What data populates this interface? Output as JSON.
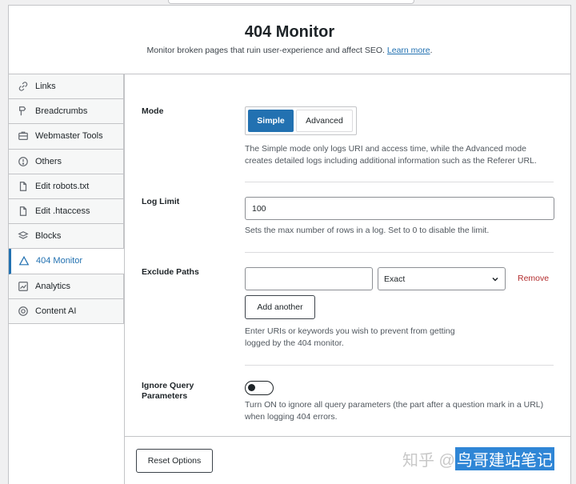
{
  "header": {
    "title": "404 Monitor",
    "subtitle": "Monitor broken pages that ruin user-experience and affect SEO.",
    "learn_more": "Learn more",
    "period": "."
  },
  "sidebar": {
    "items": [
      {
        "label": "Links",
        "icon": "links-icon"
      },
      {
        "label": "Breadcrumbs",
        "icon": "breadcrumbs-icon"
      },
      {
        "label": "Webmaster Tools",
        "icon": "webmaster-tools-icon"
      },
      {
        "label": "Others",
        "icon": "others-icon"
      },
      {
        "label": "Edit robots.txt",
        "icon": "file-icon"
      },
      {
        "label": "Edit .htaccess",
        "icon": "file-icon"
      },
      {
        "label": "Blocks",
        "icon": "blocks-icon"
      },
      {
        "label": "404 Monitor",
        "icon": "warning-icon",
        "active": true
      },
      {
        "label": "Analytics",
        "icon": "analytics-icon"
      },
      {
        "label": "Content AI",
        "icon": "content-ai-icon"
      }
    ]
  },
  "mode": {
    "label": "Mode",
    "options": [
      "Simple",
      "Advanced"
    ],
    "selected": "Simple",
    "desc_line1": "The Simple mode only logs URI and access time, while the Advanced mode",
    "desc_line2": "creates detailed logs including additional information such as the Referer URL."
  },
  "log_limit": {
    "label": "Log Limit",
    "value": "100",
    "desc": "Sets the max number of rows in a log. Set to 0 to disable the limit."
  },
  "exclude_paths": {
    "label": "Exclude Paths",
    "path_value": "",
    "match_type": "Exact",
    "remove": "Remove",
    "add_another": "Add another",
    "desc_line1": "Enter URIs or keywords you wish to prevent from getting",
    "desc_line2": "logged by the 404 monitor."
  },
  "ignore_query": {
    "label_line1": "Ignore Query",
    "label_line2": "Parameters",
    "enabled": false,
    "desc_line1": "Turn ON to ignore all query parameters (the part after a question mark in a URL)",
    "desc_line2": "when logging 404 errors."
  },
  "footer": {
    "reset_label": "Reset Options"
  },
  "watermark": {
    "prefix": "知乎 @",
    "highlight": "鸟哥建站笔记"
  },
  "colors": {
    "accent": "#2271b1",
    "danger": "#b32d2e",
    "border": "#c3c4c7",
    "sidebar_bg": "#f6f7f7",
    "page_bg": "#f0f0f1"
  }
}
